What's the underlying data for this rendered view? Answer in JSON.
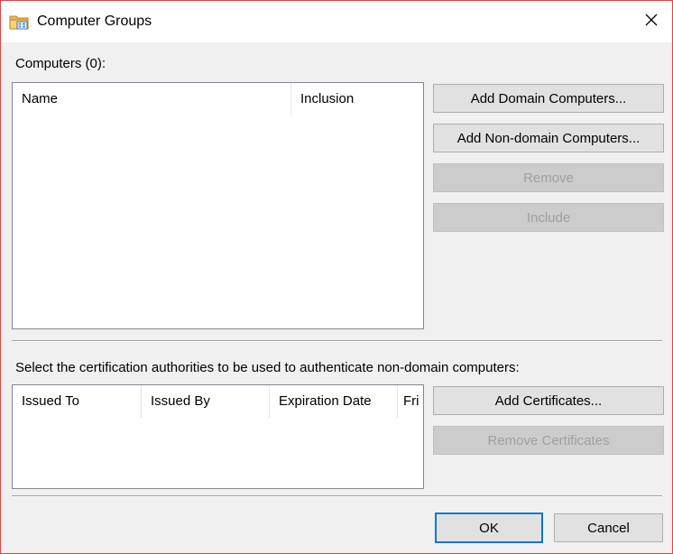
{
  "window": {
    "title": "Computer Groups",
    "icon": "computer-groups-icon",
    "close_glyph": "✕"
  },
  "computers": {
    "label": "Computers (0):",
    "columns": [
      "Name",
      "Inclusion"
    ],
    "rows": []
  },
  "computer_buttons": {
    "add_domain": "Add Domain Computers...",
    "add_non_domain": "Add Non-domain Computers...",
    "remove": "Remove",
    "include": "Include"
  },
  "certificates": {
    "label": "Select the certification authorities to be used to authenticate non-domain computers:",
    "columns": [
      "Issued To",
      "Issued By",
      "Expiration Date",
      "Fri"
    ],
    "rows": []
  },
  "certificate_buttons": {
    "add": "Add Certificates...",
    "remove": "Remove Certificates"
  },
  "footer": {
    "ok": "OK",
    "cancel": "Cancel"
  },
  "colors": {
    "window_border": "#e0433f",
    "default_button_border": "#0078d7"
  }
}
